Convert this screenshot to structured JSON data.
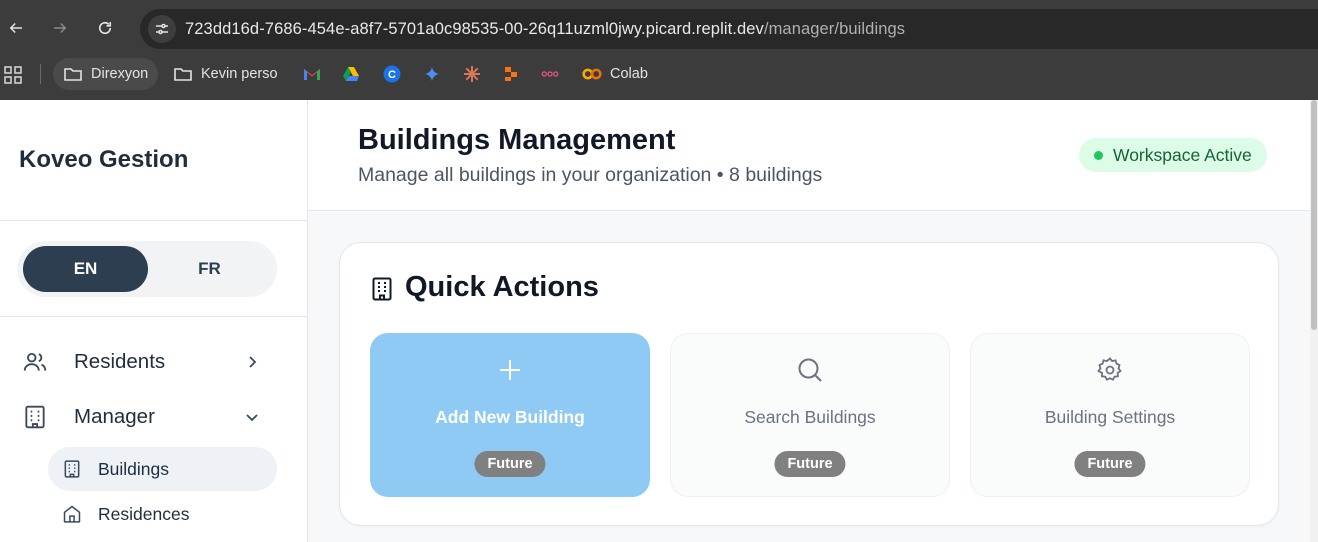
{
  "browser": {
    "url_host": "723dd16d-7686-454e-a8f7-5701a0c98535-00-26q11uzml0jwy.picard.replit.dev",
    "url_path": "/manager/buildings",
    "bookmarks": [
      {
        "label": "Direxyon",
        "icon": "folder-icon"
      },
      {
        "label": "Kevin perso",
        "icon": "folder-icon"
      },
      {
        "label": "",
        "icon": "gmail-icon"
      },
      {
        "label": "",
        "icon": "drive-icon"
      },
      {
        "label": "",
        "icon": "c-app-icon"
      },
      {
        "label": "",
        "icon": "gemini-icon"
      },
      {
        "label": "",
        "icon": "claude-icon"
      },
      {
        "label": "",
        "icon": "orange-tool-icon"
      },
      {
        "label": "",
        "icon": "link-tool-icon"
      },
      {
        "label": "Colab",
        "icon": "colab-icon"
      }
    ]
  },
  "sidebar": {
    "brand": "Koveo Gestion",
    "lang_en": "EN",
    "lang_fr": "FR",
    "nav": {
      "residents": "Residents",
      "manager": "Manager"
    },
    "sub": {
      "buildings": "Buildings",
      "residences": "Residences"
    }
  },
  "header": {
    "title": "Buildings Management",
    "subtitle": "Manage all buildings in your organization • 8 buildings",
    "status": "Workspace Active"
  },
  "quick_actions": {
    "title": "Quick Actions",
    "tiles": [
      {
        "label": "Add New Building",
        "badge": "Future",
        "icon": "plus-icon"
      },
      {
        "label": "Search Buildings",
        "badge": "Future",
        "icon": "search-icon"
      },
      {
        "label": "Building Settings",
        "badge": "Future",
        "icon": "gear-icon"
      }
    ]
  },
  "colors": {
    "primary_tile": "#8ecaf4",
    "brand_dark": "#2c3e50",
    "active_green": "#22c55e"
  }
}
